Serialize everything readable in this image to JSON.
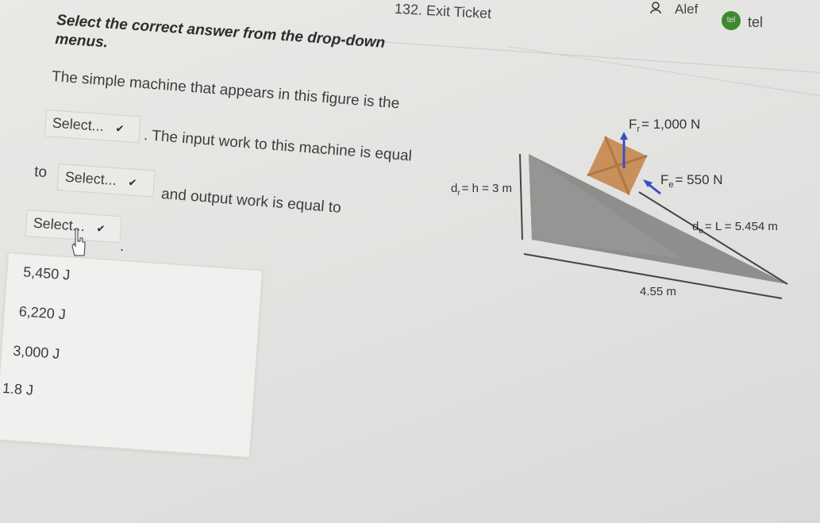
{
  "header": {
    "ticket": "132. Exit Ticket",
    "user_name": "Alef",
    "avatar_text": "tel",
    "avatar_label": "tel"
  },
  "instructions": "Select the correct answer from the drop-down menus.",
  "question": {
    "line1": "The simple machine that appears in this figure is the",
    "line2": ". The input work to this machine is equal",
    "line_to": "to",
    "line3": "and output work is equal to",
    "end": "."
  },
  "dropdowns": {
    "d1": "Select...",
    "d2": "Select...",
    "d3": "Select..."
  },
  "options": [
    "5,450 J",
    "6,220 J",
    "3,000 J",
    "1.8 J"
  ],
  "figure": {
    "fr": "F",
    "fr_sub": "r",
    "fr_value": "= 1,000 N",
    "fe": "F",
    "fe_sub": "e",
    "fe_value": "= 550 N",
    "dr": "d",
    "dr_sub": "r",
    "dr_value": "= h = 3 m",
    "de": "d",
    "de_sub": "e",
    "de_value": "= L = 5.454 m",
    "base": "4.55 m"
  },
  "colors": {
    "crate": "#c9905c",
    "ramp": "#8e8e8c",
    "arrow": "#3b4ec4"
  }
}
